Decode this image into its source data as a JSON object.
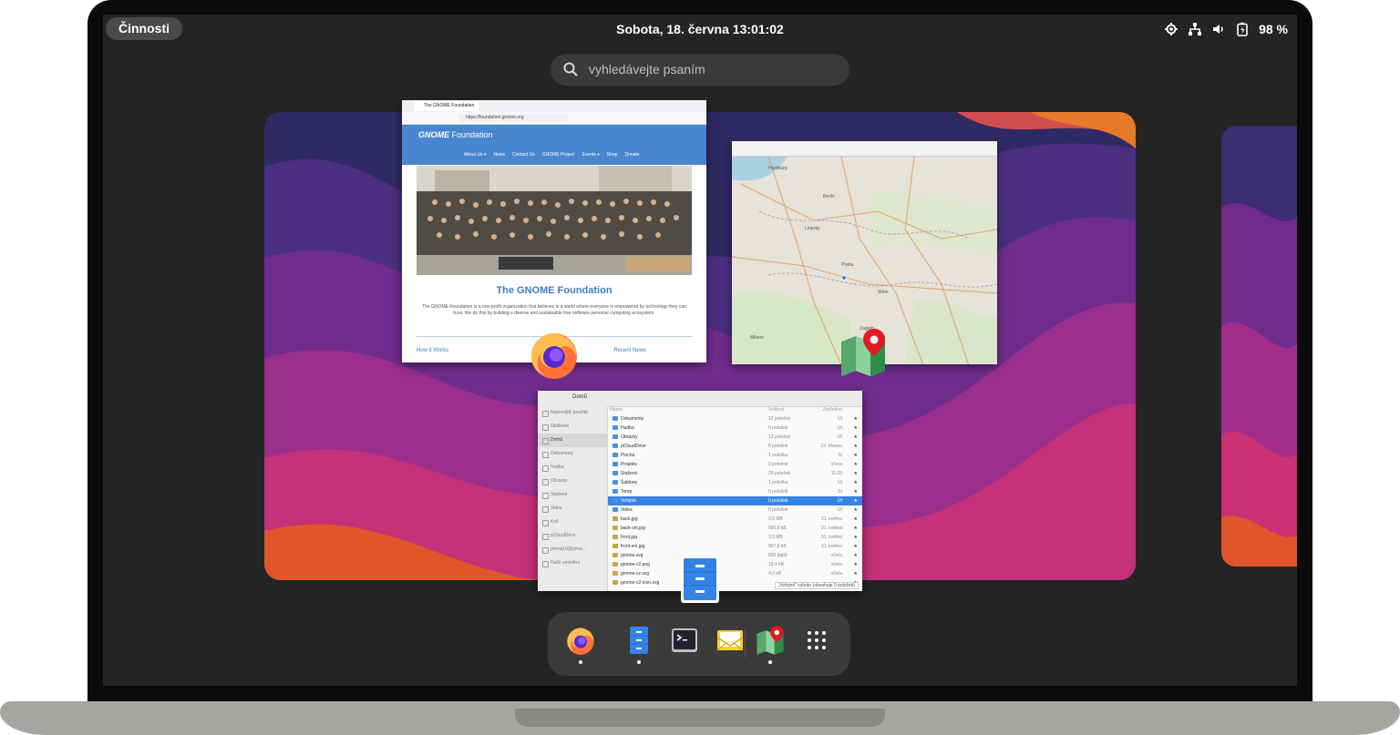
{
  "topbar": {
    "activities": "Činnosti",
    "clock": "Sobota, 18. června  13:01:02",
    "battery": "98 %",
    "tray_icons": [
      "location-icon",
      "network-icon",
      "volume-icon",
      "battery-icon"
    ]
  },
  "search": {
    "placeholder": "vyhledávejte psaním"
  },
  "windows": {
    "firefox": {
      "tab_title": "The GNOME Foundation",
      "url": "https://foundation.gnome.org",
      "site_logo": "GNOME",
      "site_name": "Foundation",
      "nav": [
        "About Us ▾",
        "News",
        "Contact Us",
        "GNOME Project",
        "Events ▾",
        "Shop",
        "Donate"
      ],
      "heading": "The GNOME Foundation",
      "body": "The GNOME Foundation is a non-profit organization that believes in a world where everyone is empowered by technology they can trust. We do this by building a diverse and sustainable free software personal computing ecosystem.",
      "link_left": "How it Works",
      "link_right": "Recent News"
    },
    "files": {
      "location": "Domů",
      "sidebar": [
        "Nejnovější použité",
        "Oblíbené",
        "Domů",
        "Dokumenty",
        "Hudba",
        "Obrázky",
        "Stažené",
        "Videa",
        "Koš",
        "pCloudDrive",
        "pervajl.0@gmai...",
        "Další umístění"
      ],
      "columns": [
        "Název",
        "Velikost",
        "Změněno"
      ],
      "rows": [
        {
          "name": "Dokumenty",
          "size": "12 položek",
          "date": "Út",
          "folder": true
        },
        {
          "name": "Hudba",
          "size": "0 položek",
          "date": "Út",
          "folder": true
        },
        {
          "name": "Obrázky",
          "size": "13 položek",
          "date": "Út",
          "folder": true
        },
        {
          "name": "pCloudDrive",
          "size": "8 položek",
          "date": "23. března",
          "folder": true
        },
        {
          "name": "Plocha",
          "size": "1 položka",
          "date": "St",
          "folder": true
        },
        {
          "name": "Projekty",
          "size": "9 položek",
          "date": "včera",
          "folder": true
        },
        {
          "name": "Stažené",
          "size": "20 položek",
          "date": "11:33",
          "folder": true
        },
        {
          "name": "Šablony",
          "size": "1 položka",
          "date": "Út",
          "folder": true
        },
        {
          "name": "Temp",
          "size": "0 položek",
          "date": "St",
          "folder": true
        },
        {
          "name": "Veřejné",
          "size": "0 položek",
          "date": "Út",
          "folder": true,
          "selected": true
        },
        {
          "name": "Videa",
          "size": "0 položek",
          "date": "Út",
          "folder": true
        },
        {
          "name": "back.jpg",
          "size": "3,5 MB",
          "date": "31. května",
          "folder": false
        },
        {
          "name": "back-sm.jpg",
          "size": "685,8 kB",
          "date": "31. května",
          "folder": false
        },
        {
          "name": "front.jpg",
          "size": "3,9 MB",
          "date": "31. května",
          "folder": false
        },
        {
          "name": "front-sm.jpg",
          "size": "907,9 kB",
          "date": "31. května",
          "folder": false
        },
        {
          "name": "gnome.svg",
          "size": "866 bajtů",
          "date": "včera",
          "folder": false
        },
        {
          "name": "gnome-c2.png",
          "size": "16,4 kB",
          "date": "včera",
          "folder": false
        },
        {
          "name": "gnome-cz.svg",
          "size": "4,0 kB",
          "date": "včera",
          "folder": false
        },
        {
          "name": "gnome-c2-icon.svg",
          "size": "",
          "date": "",
          "folder": false
        }
      ],
      "status": "„Veřejné“ vybrán (obsahuje 0 položek)"
    }
  },
  "map_labels": [
    "Hamburg",
    "Berlin",
    "Leipzig",
    "Praha",
    "Wien",
    "Zagreb",
    "Milano"
  ],
  "dash": {
    "items": [
      {
        "name": "firefox",
        "running": true
      },
      {
        "name": "files",
        "running": true
      },
      {
        "name": "terminal",
        "running": false
      },
      {
        "name": "mail",
        "running": false
      },
      {
        "name": "maps",
        "running": true
      },
      {
        "name": "app-grid",
        "running": false
      }
    ]
  },
  "colors": {
    "panel": "#242424",
    "accent": "#3584e4",
    "wallpaper": [
      "#3b2e6e",
      "#5a2f86",
      "#8b2c8f",
      "#c0307a",
      "#e0552c"
    ]
  }
}
